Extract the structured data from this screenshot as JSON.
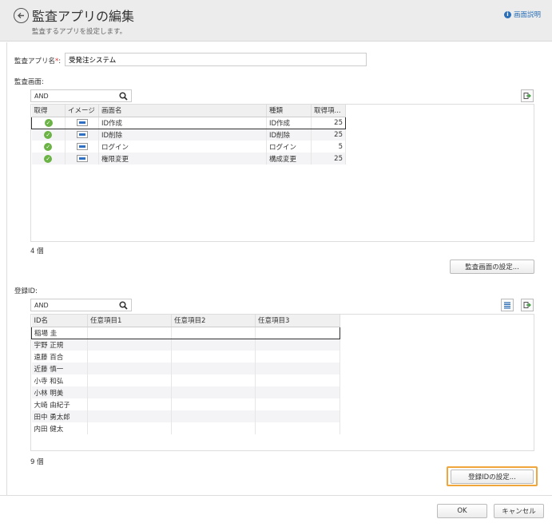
{
  "header": {
    "title": "監査アプリの編集",
    "subtitle": "監査するアプリを設定します。",
    "help_label": "画面説明"
  },
  "app_name": {
    "label": "監査アプリ名",
    "required_mark": "*",
    "colon": ":",
    "value": "受発注システム"
  },
  "screens": {
    "label": "監査画面:",
    "search_value": "AND",
    "columns": [
      "取得",
      "イメージ",
      "画面名",
      "種類",
      "取得項..."
    ],
    "rows": [
      {
        "name": "ID作成",
        "type": "ID作成",
        "count": "25"
      },
      {
        "name": "ID削除",
        "type": "ID削除",
        "count": "25"
      },
      {
        "name": "ログイン",
        "type": "ログイン",
        "count": "5"
      },
      {
        "name": "権限変更",
        "type": "構成変更",
        "count": "25"
      }
    ],
    "count_label": "4 個",
    "settings_button": "監査画面の設定..."
  },
  "ids": {
    "label": "登録ID:",
    "search_value": "AND",
    "columns": [
      "ID名",
      "任意項目1",
      "任意項目2",
      "任意項目3"
    ],
    "rows": [
      "稲場 圭",
      "宇野 正規",
      "遠藤 百合",
      "近藤 慎一",
      "小寺 和弘",
      "小林 明美",
      "大崎 由紀子",
      "田中 勇太郎",
      "内田 健太"
    ],
    "count_label": "9 個",
    "settings_button": "登録IDの設定..."
  },
  "footer": {
    "ok": "OK",
    "cancel": "キャンセル"
  },
  "colors": {
    "accent": "#2a6fb8",
    "highlight": "#f0a63a",
    "check": "#6ab344"
  }
}
